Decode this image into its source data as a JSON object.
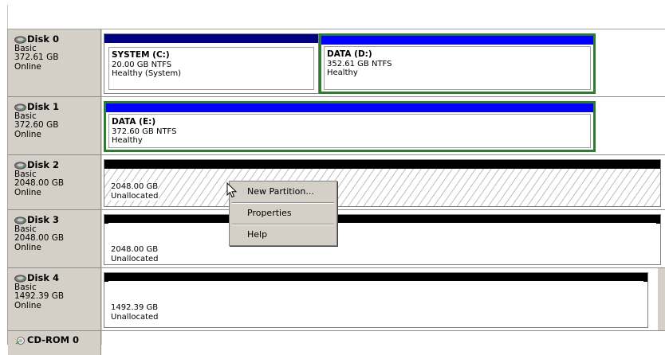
{
  "disks": [
    {
      "name": "Disk 0",
      "type": "Basic",
      "size": "372.61 GB",
      "status": "Online",
      "partitions": [
        {
          "title": "SYSTEM  (C:)",
          "size": "20.00 GB NTFS",
          "status": "Healthy (System)"
        },
        {
          "title": "DATA  (D:)",
          "size": "352.61 GB NTFS",
          "status": "Healthy"
        }
      ]
    },
    {
      "name": "Disk 1",
      "type": "Basic",
      "size": "372.60 GB",
      "status": "Online",
      "partitions": [
        {
          "title": "DATA  (E:)",
          "size": "372.60 GB NTFS",
          "status": "Healthy"
        }
      ]
    },
    {
      "name": "Disk 2",
      "type": "Basic",
      "size": "2048.00 GB",
      "status": "Online",
      "partitions": [
        {
          "size": "2048.00 GB",
          "status": "Unallocated"
        }
      ]
    },
    {
      "name": "Disk 3",
      "type": "Basic",
      "size": "2048.00 GB",
      "status": "Online",
      "partitions": [
        {
          "size": "2048.00 GB",
          "status": "Unallocated"
        }
      ]
    },
    {
      "name": "Disk 4",
      "type": "Basic",
      "size": "1492.39 GB",
      "status": "Online",
      "partitions": [
        {
          "size": "1492.39 GB",
          "status": "Unallocated"
        }
      ]
    },
    {
      "name": "CD-ROM 0"
    }
  ],
  "context_menu": {
    "items": [
      "New Partition...",
      "Properties",
      "Help"
    ]
  },
  "colors": {
    "primary_partition": "#0000ff",
    "system_partition": "#000080",
    "unallocated": "#000000",
    "selection_border": "#2e7d2e",
    "panel_bg": "#d4d0c8"
  }
}
